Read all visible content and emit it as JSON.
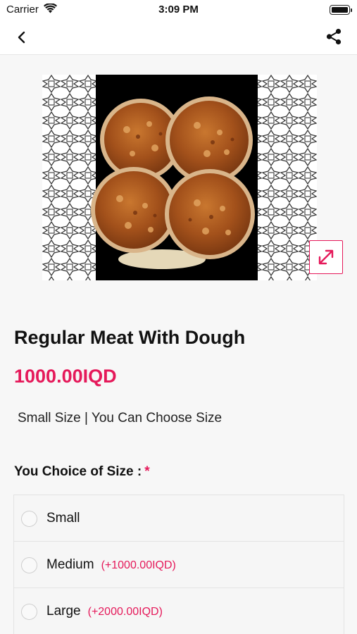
{
  "status_bar": {
    "carrier": "Carrier",
    "time": "3:09 PM"
  },
  "nav": {
    "back_icon": "chevron-left-icon",
    "share_icon": "share-icon"
  },
  "product": {
    "title": "Regular Meat With Dough",
    "price": "1000.00IQD",
    "description": "Small Size | You Can Choose Size"
  },
  "options": {
    "heading": "You Choice of Size :",
    "required_mark": "*",
    "items": [
      {
        "label": "Small",
        "extra": ""
      },
      {
        "label": "Medium",
        "extra": "(+1000.00IQD)"
      },
      {
        "label": "Large",
        "extra": "(+2000.00IQD)"
      }
    ]
  },
  "colors": {
    "accent": "#e5195a",
    "background": "#f7f7f7"
  }
}
